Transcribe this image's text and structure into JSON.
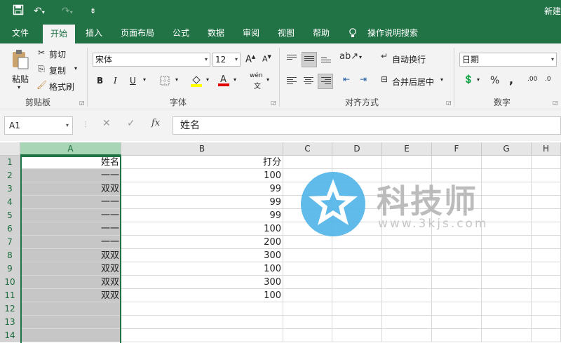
{
  "window": {
    "title": "新建"
  },
  "qat": {
    "save_icon": "save-icon",
    "undo_icon": "undo-icon",
    "redo_icon": "redo-icon",
    "customize_icon": "customize-icon"
  },
  "tabs": [
    {
      "label": "文件"
    },
    {
      "label": "开始"
    },
    {
      "label": "插入"
    },
    {
      "label": "页面布局"
    },
    {
      "label": "公式"
    },
    {
      "label": "数据"
    },
    {
      "label": "审阅"
    },
    {
      "label": "视图"
    },
    {
      "label": "帮助"
    },
    {
      "label": "操作说明搜索"
    }
  ],
  "ribbon": {
    "clipboard": {
      "paste": "粘贴",
      "cut": "剪切",
      "copy": "复制",
      "format_painter": "格式刷",
      "group": "剪贴板"
    },
    "font": {
      "name": "宋体",
      "size": "12",
      "bold": "B",
      "italic": "I",
      "underline": "U",
      "grow": "A",
      "shrink": "A",
      "phonetic": "wén",
      "group": "字体"
    },
    "alignment": {
      "wrap": "自动换行",
      "merge": "合并后居中",
      "group": "对齐方式"
    },
    "number": {
      "format": "日期",
      "percent": "%",
      "comma": ",",
      "inc_decimal": ".00",
      "dec_decimal": ".0",
      "group": "数字"
    }
  },
  "formula_bar": {
    "name_box": "A1",
    "fx": "fx",
    "value": "姓名"
  },
  "columns": [
    "A",
    "B",
    "C",
    "D",
    "E",
    "F",
    "G",
    "H"
  ],
  "rows": [
    {
      "num": "1",
      "a": "姓名",
      "b": "打分"
    },
    {
      "num": "2",
      "a": "一一",
      "b": "100"
    },
    {
      "num": "3",
      "a": "双双",
      "b": "99"
    },
    {
      "num": "4",
      "a": "一一",
      "b": "99"
    },
    {
      "num": "5",
      "a": "一一",
      "b": "99"
    },
    {
      "num": "6",
      "a": "一一",
      "b": "100"
    },
    {
      "num": "7",
      "a": "一一",
      "b": "200"
    },
    {
      "num": "8",
      "a": "双双",
      "b": "300"
    },
    {
      "num": "9",
      "a": "双双",
      "b": "100"
    },
    {
      "num": "10",
      "a": "双双",
      "b": "300"
    },
    {
      "num": "11",
      "a": "双双",
      "b": "100"
    },
    {
      "num": "12",
      "a": "",
      "b": ""
    },
    {
      "num": "13",
      "a": "",
      "b": ""
    },
    {
      "num": "14",
      "a": "",
      "b": ""
    }
  ],
  "watermark": {
    "title": "科技师",
    "url": "www.3kjs.com"
  },
  "colors": {
    "accent": "#217346",
    "selection": "#c6c6c6",
    "header_selected": "#a8d5b5",
    "watermark_blue": "#4fb3e8"
  }
}
